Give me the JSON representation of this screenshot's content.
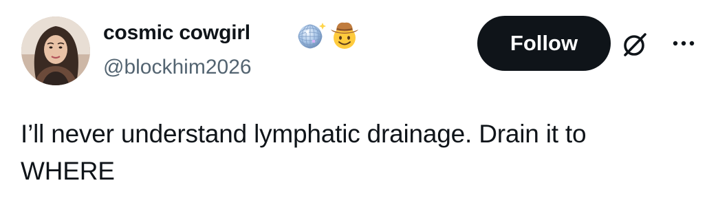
{
  "author": {
    "display_name": "cosmic cowgirl",
    "handle": "@blockhim2026",
    "name_emojis": [
      "disco-ball-icon",
      "cowboy-face-icon"
    ]
  },
  "actions": {
    "follow_label": "Follow",
    "grok_icon": "grok-icon",
    "more_icon": "more-options-icon"
  },
  "tweet": {
    "text_line_1": "I’ll never understand lymphatic drainage. Drain it to",
    "text_line_2": "WHERE"
  },
  "colors": {
    "text_primary": "#0f1419",
    "text_secondary": "#536471",
    "button_bg": "#0f1419",
    "button_text": "#ffffff",
    "background": "#ffffff"
  }
}
